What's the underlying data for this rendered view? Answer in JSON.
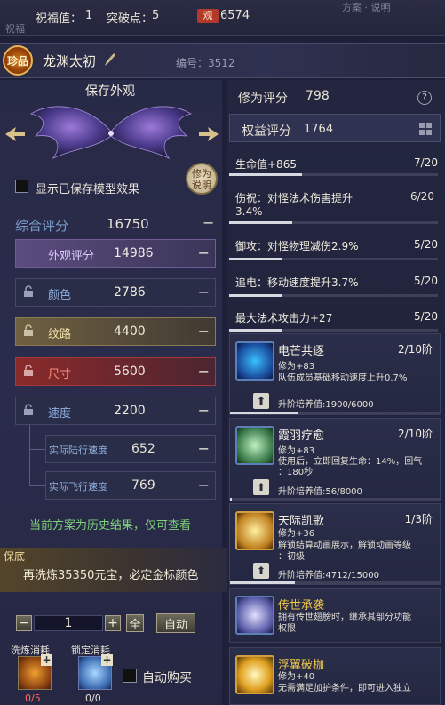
{
  "topbar": {
    "faint_tag": "祝福",
    "blessing_label": "祝福值：",
    "blessing_value": "1",
    "breakthrough_label": "突破点：",
    "breakthrough_value": "5",
    "currency_badge": "观",
    "currency_value": "6574",
    "faint_right": "方案 · 说明"
  },
  "header": {
    "rarity_badge": "珍品",
    "item_name": "龙渊太初",
    "id_label": "编号：3512"
  },
  "left": {
    "save_appearance": "保存外观",
    "show_saved_label": "显示已保存模型效果",
    "cultivation_note_btn": "修为说明",
    "rows": {
      "total": {
        "label": "综合评分",
        "value": "16750"
      },
      "appearance": {
        "label": "外观评分",
        "value": "14986"
      },
      "color": {
        "label": "颜色",
        "value": "2786"
      },
      "pattern": {
        "label": "纹路",
        "value": "4400"
      },
      "size": {
        "label": "尺寸",
        "value": "5600"
      },
      "speed": {
        "label": "速度",
        "value": "2200"
      },
      "land_speed": {
        "label": "实际陆行速度",
        "value": "652"
      },
      "fly_speed": {
        "label": "实际飞行速度",
        "value": "769"
      }
    },
    "history_note": "当前方案为历史结果，仅可查看",
    "guarantee_tab": "保底",
    "guarantee_text": "再洗炼35350元宝，必定金标颜色",
    "quantity": "1",
    "all_btn": "全",
    "auto_btn": "自动",
    "refine_cost_label": "洗炼消耗",
    "refine_cost_count": "0/5",
    "lock_cost_label": "锁定消耗",
    "lock_cost_count": "0/0",
    "auto_buy_label": "自动购买"
  },
  "right": {
    "cultivation_score_label": "修为评分",
    "cultivation_score_value": "798",
    "rights_score_label": "权益评分",
    "rights_score_value": "1764",
    "stats": [
      {
        "text": "生命值+865",
        "frac": "7/20",
        "progress": 0.35
      },
      {
        "text": "伤祝：对怪法术伤害提升3.4%",
        "text2": "3.4%",
        "frac": "6/20",
        "progress": 0.3
      },
      {
        "text": "御攻：对怪物理减伤2.9%",
        "frac": "5/20",
        "progress": 0.25
      },
      {
        "text": "追电：移动速度提升3.7%",
        "frac": "5/20",
        "progress": 0.25
      },
      {
        "text": "最大法术攻击力+27",
        "frac": "5/20",
        "progress": 0.25
      }
    ],
    "skills": [
      {
        "name": "电芒共逐",
        "tier": "2/10阶",
        "line1": "修为+83",
        "line2": "队伍成员基础移动速度上升0.7%",
        "upgrade": "升阶培养值:1900/6000",
        "progress": 0.32
      },
      {
        "name": "霞羽疗愈",
        "tier": "2/10阶",
        "line1": "修为+83",
        "line2": "使用后，立即回复生命：14%，回气",
        "line3": "：180秒",
        "upgrade": "升阶培养值:56/8000",
        "progress": 0.01
      },
      {
        "name": "天际凯歌",
        "tier": "1/3阶",
        "line1": "修为+36",
        "line2": "解锁结算动画展示，解锁动画等级",
        "line3": "：初级",
        "upgrade": "升阶培养值:4712/15000",
        "progress": 0.31
      },
      {
        "name": "传世承袭",
        "line1": "拥有传世翅膀时，继承其部分功能",
        "line2": "权限"
      },
      {
        "name": "浮翼破枷",
        "line1": "修为+40",
        "line2": "无需满足加护条件，即可进入独立"
      }
    ]
  },
  "colors": {
    "accent_gold": "#f0c84a",
    "history_green": "#7ed07a",
    "appearance_purple": "#5b4c7e",
    "size_red": "#8b2a2a"
  }
}
